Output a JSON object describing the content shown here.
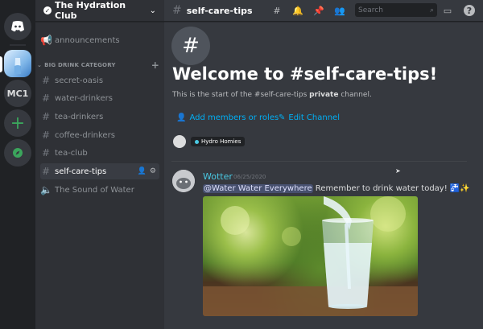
{
  "server": {
    "name": "The Hydration Club"
  },
  "guilds": {
    "mc1_label": "MC1"
  },
  "sidebar": {
    "category": "BIG DRINK CATEGORY",
    "channels": [
      {
        "label": "announcements"
      },
      {
        "label": "secret-oasis"
      },
      {
        "label": "water-drinkers"
      },
      {
        "label": "tea-drinkers"
      },
      {
        "label": "coffee-drinkers"
      },
      {
        "label": "tea-club"
      },
      {
        "label": "self-care-tips"
      },
      {
        "label": "The Sound of Water"
      }
    ]
  },
  "topbar": {
    "channel": "self-care-tips",
    "search_placeholder": "Search"
  },
  "main": {
    "welcome_title": "Welcome to #self-care-tips!",
    "start_prefix": "This is the start of the #self-care-tips ",
    "start_bold": "private",
    "start_suffix": " channel.",
    "add_members": "Add members or roles",
    "edit_channel": "Edit Channel",
    "role_name": "Hydro Homies"
  },
  "message": {
    "author": "Wotter",
    "timestamp": "06/25/2020",
    "mention": "@Water Water Everywhere",
    "text": " Remember to drink water today! 🚰✨"
  },
  "colors": {
    "accent": "#00aff4",
    "author": "#4ac9e3",
    "success": "#3ba55c"
  }
}
